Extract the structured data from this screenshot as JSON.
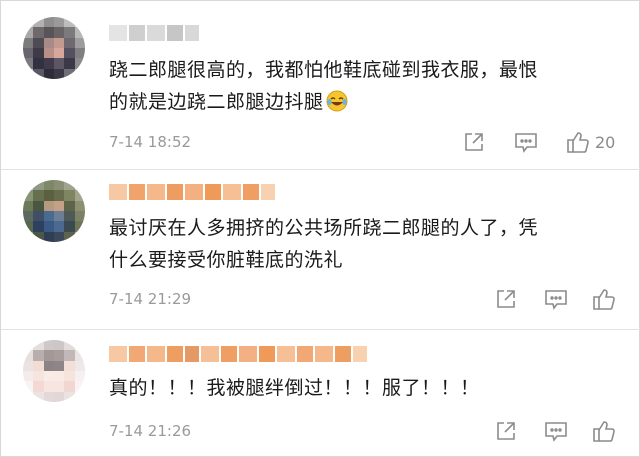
{
  "comments": [
    {
      "username": "",
      "text_line1": "跷二郎腿很高的，我都怕他鞋底碰到我衣服，最恨",
      "text_line2": "的就是边跷二郎腿边抖腿",
      "emoji": "laughing-crying-emoji",
      "time": "7-14 18:52",
      "likes": "20"
    },
    {
      "username": "",
      "text_line1": "最讨厌在人多拥挤的公共场所跷二郎腿的人了，凭",
      "text_line2": "什么要接受你脏鞋底的洗礼",
      "time": "7-14 21:29",
      "likes": ""
    },
    {
      "username": "",
      "text_line1": "真的！！！我被腿绊倒过！！！服了！！！",
      "time": "7-14 21:26",
      "likes": ""
    }
  ],
  "icons": {
    "share": "share-icon",
    "comment": "comment-icon",
    "like": "like-icon"
  },
  "colors": {
    "meta_text": "#9a9a9a",
    "icon_stroke": "#8c8c8c",
    "username_mosaic": "#f0a36a"
  }
}
